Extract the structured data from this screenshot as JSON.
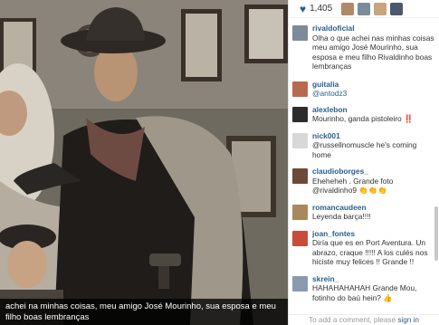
{
  "photo": {
    "description_icon": "photo",
    "caption": "achei na minhas coisas, meu amigo José Mourinho, sua esposa e meu filho boas lembranças"
  },
  "likes": {
    "icon": "heart-icon",
    "count": "1,405",
    "liker_colors": [
      "#b08a68",
      "#7a8c9a",
      "#c9a57d",
      "#4a5a6a",
      "#9a7a5a",
      "#d0b090",
      "#6c6c6c",
      "#8f6b4f"
    ]
  },
  "comments": [
    {
      "user": "rivaldoficial",
      "text": "Olha o que achei nas minhas coisas meu amigo José Mourinho, sua esposa e meu filho Rivaldinho boas lembranças",
      "avatar_color": "#7d8a99"
    },
    {
      "user": "guitalia",
      "text": "@antodz3",
      "avatar_color": "#b96a4d"
    },
    {
      "user": "alexlebon",
      "text": "Mourinho, ganda pistoleiro ‼️",
      "avatar_color": "#2c2c2c"
    },
    {
      "user": "nick001",
      "text": "@russellnomuscle he's coming home",
      "avatar_color": "#d8d8d8"
    },
    {
      "user": "claudioborges_",
      "text": "Eheheheh . Grande foto @rivaldinho9 👏👏👏",
      "avatar_color": "#6b4a3a"
    },
    {
      "user": "romancaudeen",
      "text": "Leyenda barça!!!!",
      "avatar_color": "#a8885c"
    },
    {
      "user": "joan_fontes",
      "text": "Diría que es en Port Aventura. Un abrazo, craque !!!!! A los culés nos hiciste muy felices !! Grande !!",
      "avatar_color": "#c94b3a"
    },
    {
      "user": "skrein_",
      "text": "HAHAHAHAHAH Grande Mou, fotinho do baú hein? 👍",
      "avatar_color": "#8a9bb0"
    }
  ],
  "add_comment": {
    "placeholder": "To add a comment, please",
    "signin_label": "sign in"
  }
}
